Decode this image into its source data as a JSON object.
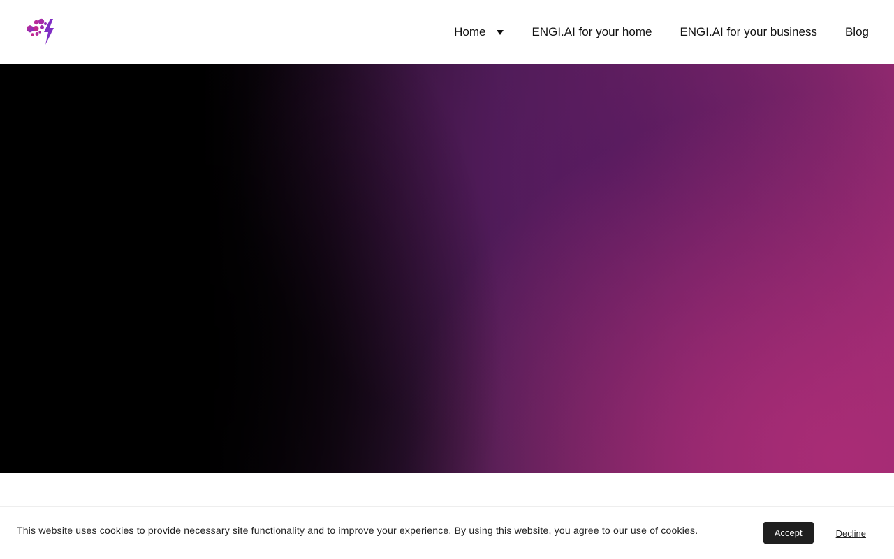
{
  "header": {
    "logo_icon": "hexagon-cluster-lightning-logo",
    "nav": {
      "home_label": "Home",
      "home_icon": "caret-down-icon",
      "home_ai_label": "ENGI.AI for your home",
      "business_ai_label": "ENGI.AI for your business",
      "blog_label": "Blog"
    }
  },
  "hero": {
    "colors": {
      "dark": "#000000",
      "purple": "#561a60",
      "magenta": "#aa2c76"
    }
  },
  "cookie_banner": {
    "message": "This website uses cookies to provide necessary site functionality and to improve your experience. By using this website, you agree to our use of cookies.",
    "accept_label": "Accept",
    "decline_label": "Decline"
  }
}
